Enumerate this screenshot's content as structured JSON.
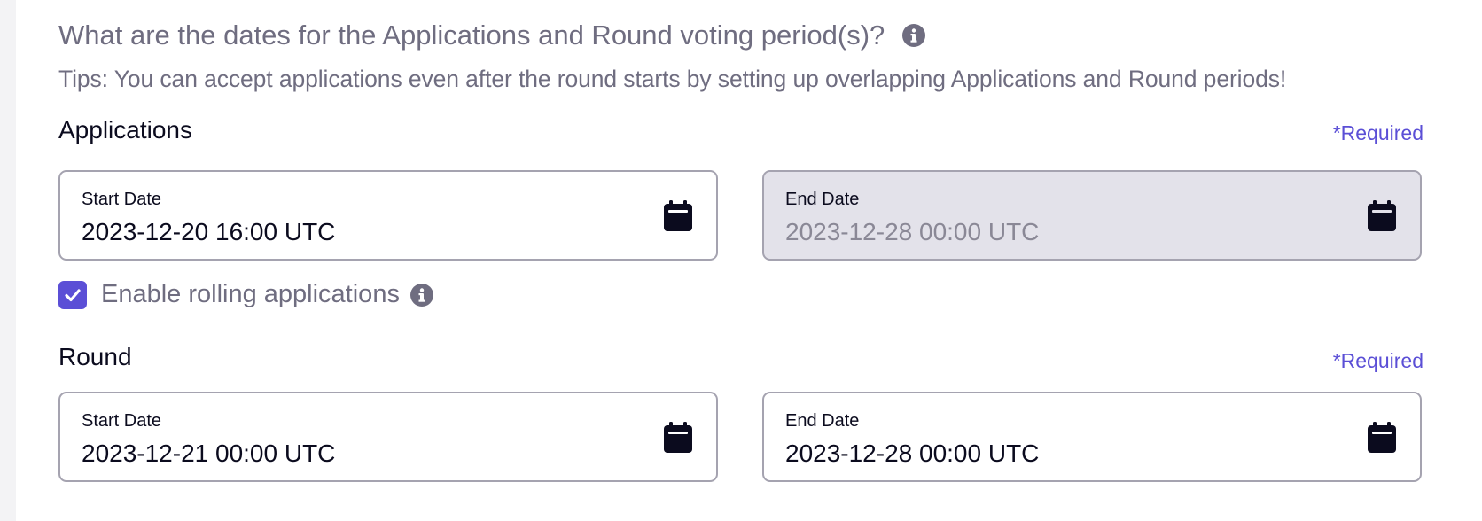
{
  "question": "What are the dates for the Applications and Round voting period(s)?",
  "tips": "Tips: You can accept applications even after the round starts by setting up overlapping Applications and Round periods!",
  "applications": {
    "label": "Applications",
    "required": "*Required",
    "start": {
      "label": "Start Date",
      "value": "2023-12-20 16:00 UTC"
    },
    "end": {
      "label": "End Date",
      "value": "2023-12-28 00:00 UTC",
      "disabled": true
    }
  },
  "rolling": {
    "label": "Enable rolling applications",
    "checked": true
  },
  "round": {
    "label": "Round",
    "required": "*Required",
    "start": {
      "label": "Start Date",
      "value": "2023-12-21 00:00 UTC"
    },
    "end": {
      "label": "End Date",
      "value": "2023-12-28 00:00 UTC"
    }
  },
  "colors": {
    "accent": "#5b4fd6",
    "muted_text": "#6f6d80",
    "dark": "#0b0b1e",
    "disabled_bg": "#e3e2ea"
  },
  "icons": [
    "info-icon",
    "calendar-icon",
    "check-icon"
  ]
}
